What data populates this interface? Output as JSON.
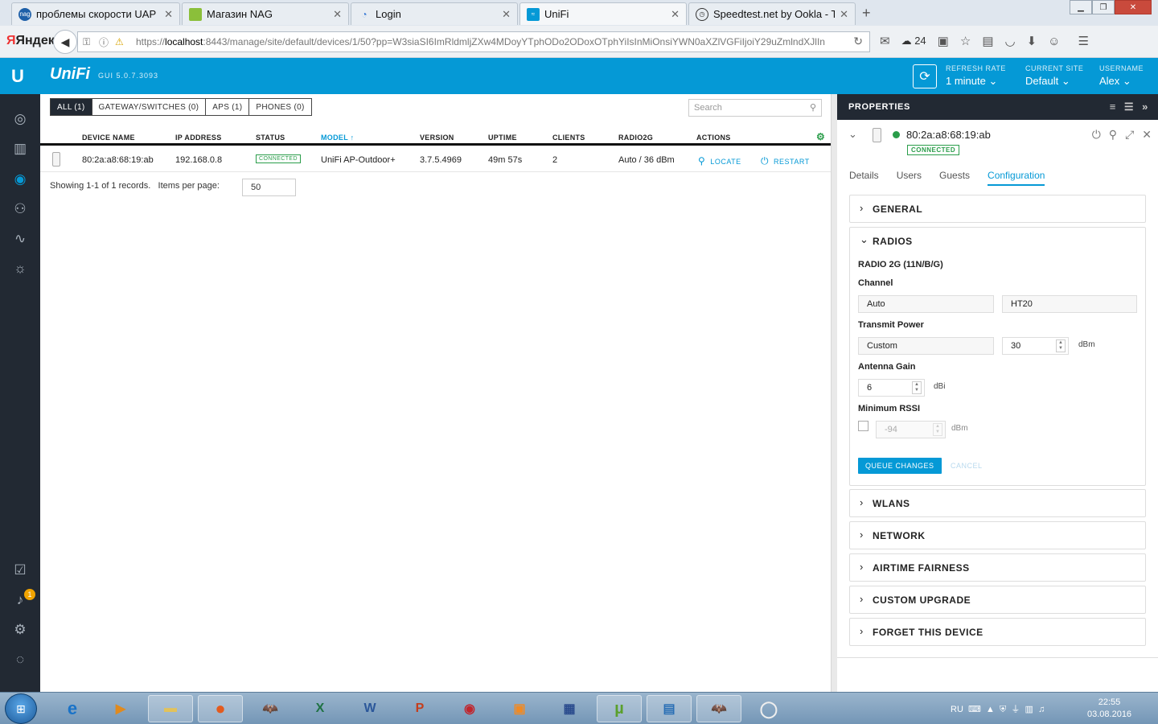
{
  "browser": {
    "tabs": [
      {
        "label": "проблемы скорости UAP ..."
      },
      {
        "label": "Магазин NAG"
      },
      {
        "label": "Login"
      },
      {
        "label": "UniFi"
      },
      {
        "label": "Speedtest.net by Ookla - T..."
      }
    ],
    "brand": "Яндекс",
    "url_prefix": "https://",
    "url_host": "localhost",
    "url_rest": ":8443/manage/site/default/devices/1/50?pp=W3siaSI6ImRldmljZXw4MDoyYTphODo2ODoxOTphYiIsInMiOnsiYWN0aXZlVGFiIjoiY29uZmlndXJlIn",
    "weather": "24"
  },
  "header": {
    "brand": "UniFi",
    "version": "GUI 5.0.7.3093",
    "refresh_label": "REFRESH RATE",
    "refresh_value": "1 minute",
    "site_label": "CURRENT SITE",
    "site_value": "Default",
    "user_label": "USERNAME",
    "user_value": "Alex"
  },
  "sidebar": {
    "alerts_badge": "1"
  },
  "filters": [
    "ALL (1)",
    "GATEWAY/SWITCHES (0)",
    "APS (1)",
    "PHONES (0)"
  ],
  "search": {
    "placeholder": "Search"
  },
  "table": {
    "columns": [
      "DEVICE NAME",
      "IP ADDRESS",
      "STATUS",
      "MODEL",
      "VERSION",
      "UPTIME",
      "CLIENTS",
      "RADIO2G",
      "ACTIONS"
    ],
    "rows": [
      {
        "name": "80:2a:a8:68:19:ab",
        "ip": "192.168.0.8",
        "status": "CONNECTED",
        "model": "UniFi AP-Outdoor+",
        "version": "3.7.5.4969",
        "uptime": "49m 57s",
        "clients": "2",
        "radio2g": "Auto / 36 dBm",
        "locate": "LOCATE",
        "restart": "RESTART"
      }
    ],
    "showing": "Showing 1-1 of 1 records.",
    "ipp_label": "Items per page:",
    "ipp_value": "50"
  },
  "props": {
    "title": "PROPERTIES",
    "mac": "80:2a:a8:68:19:ab",
    "status": "CONNECTED",
    "tabs": [
      "Details",
      "Users",
      "Guests",
      "Configuration"
    ],
    "sections": {
      "general": "GENERAL",
      "radios": "RADIOS",
      "wlans": "WLANS",
      "network": "NETWORK",
      "airtime": "AIRTIME FAIRNESS",
      "upgrade": "CUSTOM UPGRADE",
      "forget": "FORGET THIS DEVICE"
    },
    "radio": {
      "title": "RADIO 2G (11N/B/G)",
      "channel_label": "Channel",
      "channel_value": "Auto",
      "width_value": "HT20",
      "tx_label": "Transmit Power",
      "tx_mode": "Custom",
      "tx_value": "30",
      "tx_unit": "dBm",
      "gain_label": "Antenna Gain",
      "gain_value": "6",
      "gain_unit": "dBi",
      "rssi_label": "Minimum RSSI",
      "rssi_value": "-94",
      "rssi_unit": "dBm",
      "queue": "QUEUE CHANGES",
      "cancel": "CANCEL"
    }
  },
  "taskbar": {
    "lang": "RU",
    "time": "22:55",
    "date": "03.08.2016"
  }
}
